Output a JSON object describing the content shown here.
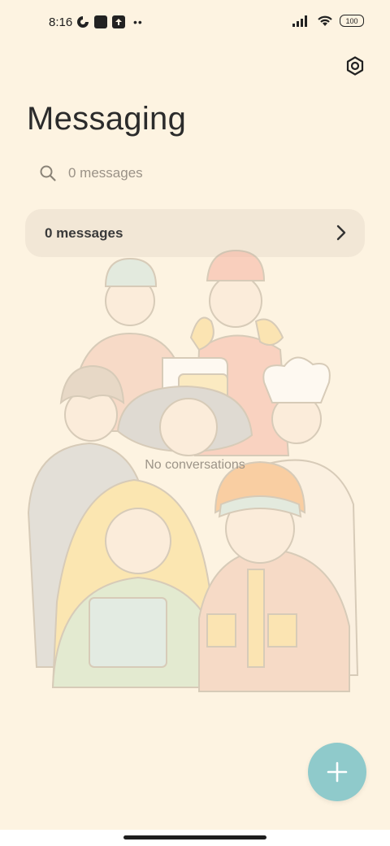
{
  "status_bar": {
    "time": "8:16",
    "battery": "100"
  },
  "header": {
    "title": "Messaging"
  },
  "search": {
    "placeholder": "0 messages"
  },
  "summary_card": {
    "label": "0 messages"
  },
  "empty_state": {
    "text": "No conversations"
  },
  "colors": {
    "background": "#fdf3e1",
    "card": "#f2e7d6",
    "fab": "#8fcacb"
  },
  "icons": [
    "settings-icon",
    "search-icon",
    "chevron-right-icon",
    "plus-icon"
  ]
}
